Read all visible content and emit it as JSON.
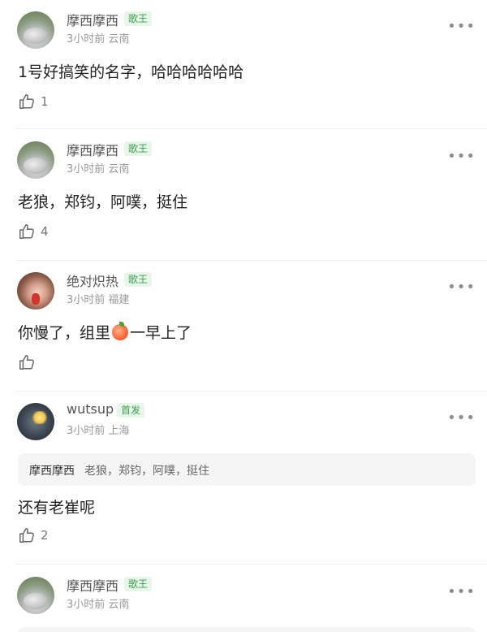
{
  "comments": [
    {
      "name": "摩西摩西",
      "badge": "歌王",
      "time": "3小时前",
      "location": "云南",
      "text": "1号好搞笑的名字，哈哈哈哈哈哈",
      "likes": "1",
      "avatar": "cat-avatar"
    },
    {
      "name": "摩西摩西",
      "badge": "歌王",
      "time": "3小时前",
      "location": "云南",
      "text": "老狼，郑钧，阿噗，挺住",
      "likes": "4",
      "avatar": "cat-avatar"
    },
    {
      "name": "绝对炽热",
      "badge": "歌王",
      "time": "3小时前",
      "location": "福建",
      "text_before": "你慢了，组里",
      "text_emoji": "peach-emoji",
      "text_after": "一早上了",
      "likes": "",
      "avatar": "girl-avatar"
    },
    {
      "name": "wutsup",
      "badge": "首发",
      "time": "3小时前",
      "location": "上海",
      "quote_name": "摩西摩西",
      "quote_text": "老狼，郑钧，阿噗，挺住",
      "text": "还有老崔呢",
      "likes": "2",
      "avatar": "dark-avatar"
    },
    {
      "name": "摩西摩西",
      "badge": "歌王",
      "time": "3小时前",
      "location": "云南",
      "avatar": "cat-avatar"
    }
  ],
  "more_icon": "•••",
  "colors": {
    "badge_text": "#35a34a",
    "badge_bg": "#e9f6ea",
    "meta": "#9a9a9a"
  }
}
